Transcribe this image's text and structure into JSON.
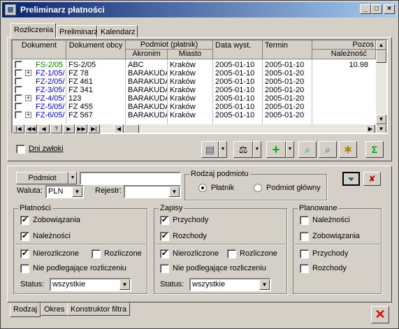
{
  "title": "Preliminarz płatności",
  "controls": {
    "min": "_",
    "max": "□",
    "close": "×"
  },
  "top_tabs": [
    "Rozliczenia",
    "Preliminarz",
    "Kalendarz"
  ],
  "headers": {
    "dokument": "Dokument",
    "obcy": "Dokument obcy",
    "podmiot": "Podmiot (płatnik)",
    "akronim": "Akronim",
    "miasto": "Miasto",
    "data": "Data wyst.",
    "termin": "Termin",
    "pozos": "Pozos",
    "naleznosc": "Należność"
  },
  "rows": [
    {
      "dok": "FS-2/05",
      "obcy": "FS-2/05",
      "akr": "ABC",
      "mia": "Kraków",
      "data": "2005-01-10",
      "term": "2005-01-10",
      "nal": "10.98",
      "exp": false,
      "color": "#008000"
    },
    {
      "dok": "FZ-1/05/",
      "obcy": "FZ 78",
      "akr": "BARAKUDA",
      "mia": "Kraków",
      "data": "2005-01-10",
      "term": "2005-01-20",
      "nal": "",
      "exp": true,
      "color": "#0000c0"
    },
    {
      "dok": "FZ-2/05/",
      "obcy": "FZ 461",
      "akr": "BARAKUDA",
      "mia": "Kraków",
      "data": "2005-01-10",
      "term": "2005-01-20",
      "nal": "",
      "exp": false,
      "color": "#0000c0"
    },
    {
      "dok": "FZ-3/05/",
      "obcy": "FZ 341",
      "akr": "BARAKUDA",
      "mia": "Kraków",
      "data": "2005-01-10",
      "term": "2005-01-20",
      "nal": "",
      "exp": false,
      "color": "#0000c0"
    },
    {
      "dok": "FZ-4/05/",
      "obcy": "123",
      "akr": "BARAKUDA",
      "mia": "Kraków",
      "data": "2005-01-10",
      "term": "2005-01-20",
      "nal": "",
      "exp": true,
      "color": "#0000c0"
    },
    {
      "dok": "FZ-5/05/",
      "obcy": "FZ 455",
      "akr": "BARAKUDA",
      "mia": "Kraków",
      "data": "2005-01-10",
      "term": "2005-01-20",
      "nal": "",
      "exp": false,
      "color": "#0000c0"
    },
    {
      "dok": "FZ-6/05/",
      "obcy": "FZ 567",
      "akr": "BARAKUDA",
      "mia": "Kraków",
      "data": "2005-01-10",
      "term": "2005-01-20",
      "nal": "",
      "exp": true,
      "color": "#0000c0"
    }
  ],
  "nav": [
    "|◀",
    "◀◀",
    "◀",
    "?",
    "▶",
    "▶▶",
    "▶|"
  ],
  "dni_zwloki": "Dni zwłoki",
  "filter": {
    "podmiot_btn": "Podmiot",
    "podmiot_value": "",
    "waluta_label": "Waluta:",
    "waluta_value": "PLN",
    "rejestr_label": "Rejestr:",
    "rejestr_value": "",
    "rodzaj_legend": "Rodzaj podmiotu",
    "platnik": "Płatnik",
    "podmiot_glowny": "Podmiot główny"
  },
  "platnosci": {
    "legend": "Płatności",
    "zob": "Zobowiązania",
    "nal": "Należności",
    "nierozl": "Nierozliczone",
    "rozl": "Rozliczone",
    "niepodl": "Nie podlegające rozliczeniu",
    "status_label": "Status:",
    "status_value": "wszystkie"
  },
  "zapisy": {
    "legend": "Zapisy",
    "przych": "Przychody",
    "rozch": "Rozchody",
    "nierozl": "Nierozliczone",
    "rozl": "Rozliczone",
    "niepodl": "Nie podlegające rozliczeniu",
    "status_label": "Status:",
    "status_value": "wszystkie"
  },
  "planowane": {
    "legend": "Planowane",
    "nal": "Należności",
    "zob": "Zobowiązania",
    "przych": "Przychody",
    "rozch": "Rozchody"
  },
  "bottom_tabs": [
    "Rodzaj",
    "Okres",
    "Konstruktor filtra"
  ]
}
